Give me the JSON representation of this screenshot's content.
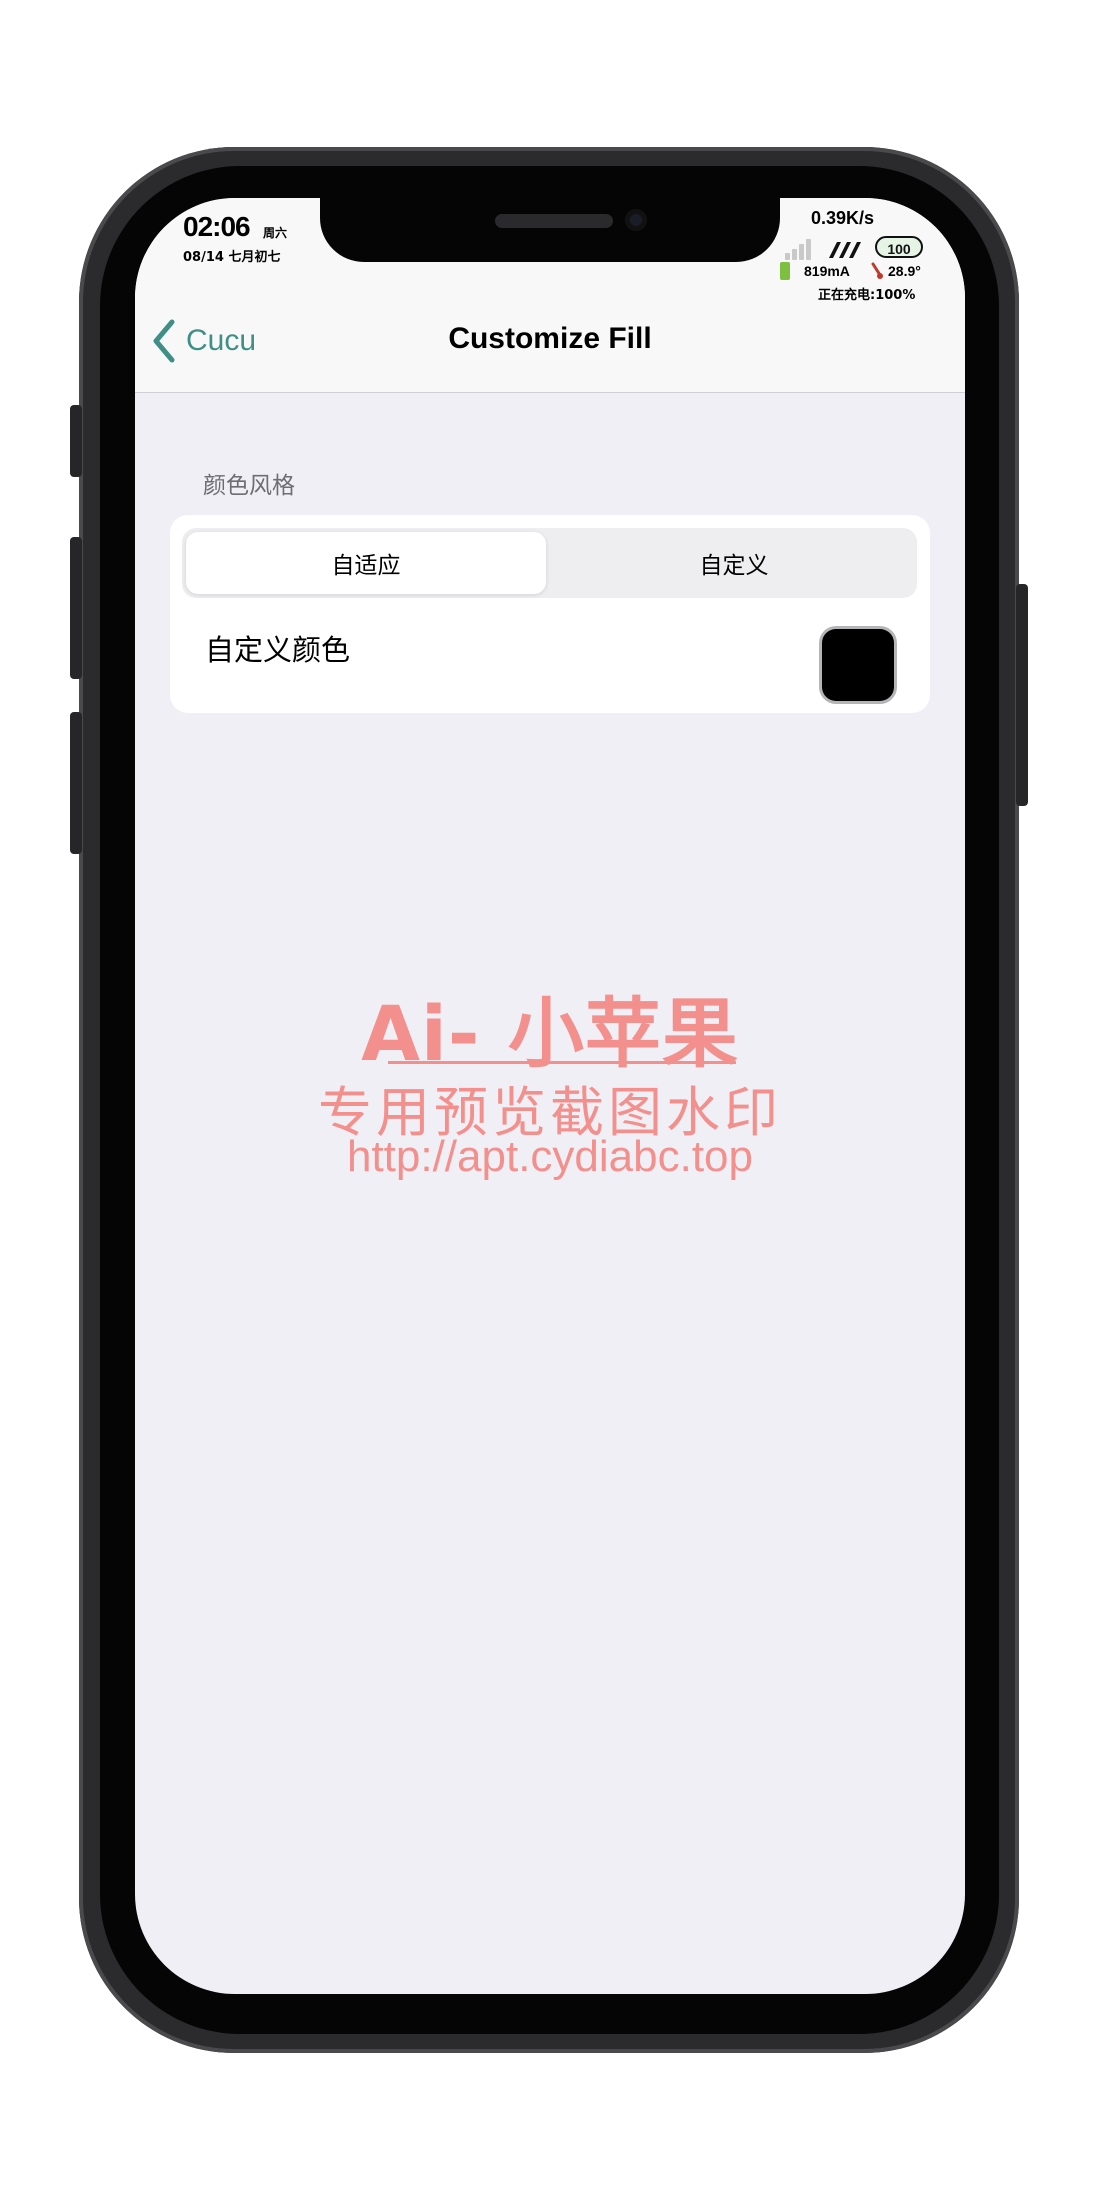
{
  "status_bar": {
    "time": "02:06",
    "weekday": "周六",
    "date": "08/14 七月初七",
    "net_speed": "0.39K/s",
    "battery_level": "100",
    "current": "819mA",
    "temperature": "28.9°",
    "charging_text": "正在充电:100%"
  },
  "nav": {
    "back_label": "Cucu",
    "title": "Customize Fill"
  },
  "color_style": {
    "section_header": "颜色风格",
    "segments": [
      "自适应",
      "自定义"
    ],
    "selected_segment": "自适应",
    "custom_color_label": "自定义颜色",
    "custom_color_value": "#000000"
  },
  "watermark": {
    "line1": "Ai- 小苹果",
    "line2": "专用预览截图水印",
    "line3": "http://apt.cydiabc.top",
    "color": "#f3908d"
  },
  "colors": {
    "accent": "#3f8f87",
    "background": "#f0eff5"
  }
}
